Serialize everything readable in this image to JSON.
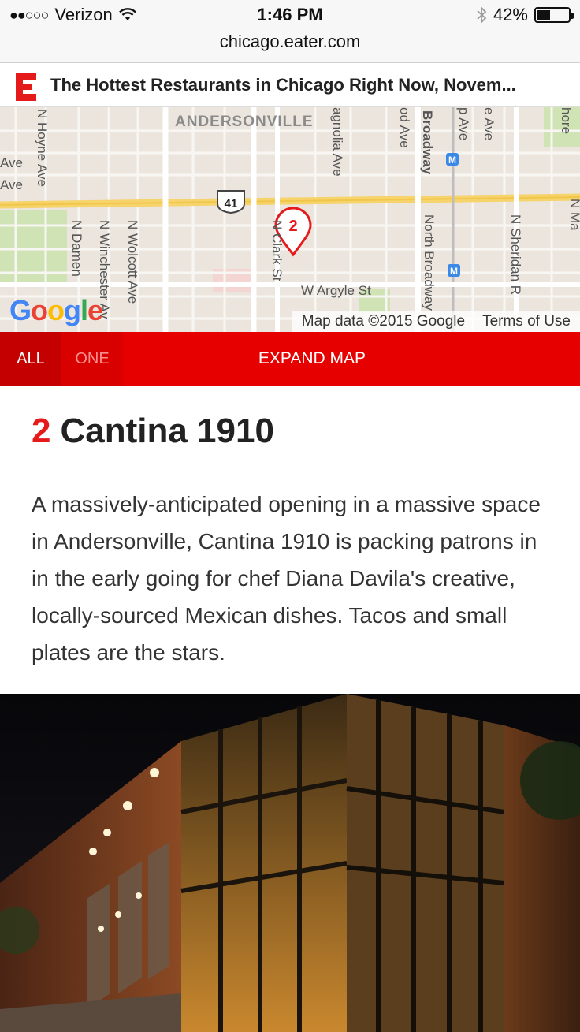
{
  "status": {
    "carrier": "Verizon",
    "time": "1:46 PM",
    "battery": "42%",
    "battery_level": 0.42,
    "url": "chicago.eater.com"
  },
  "header": {
    "logo_letter": "E",
    "title": "The Hottest Restaurants in Chicago Right Now, Novem..."
  },
  "map": {
    "neighborhood": "ANDERSONVILLE",
    "streets": [
      "N Hoyne Ave",
      "N Damen",
      "N Winchester Av",
      "N Wolcott Ave",
      "N Clark St",
      "W Argyle St",
      "Broadway",
      "North Broadway",
      "N Sheridan R",
      "agnolia Ave",
      "od Ave",
      "p Ave",
      "e Ave",
      "Ave",
      "Ave",
      "N Ma",
      "hore"
    ],
    "highway_shield": "41",
    "marker_number": "2",
    "attribution": "Map data ©2015 Google",
    "terms": "Terms of Use",
    "google_logo": "Google"
  },
  "tabs": {
    "all": "ALL",
    "one": "ONE",
    "expand": "EXPAND MAP"
  },
  "entry": {
    "number": "2",
    "name": "Cantina 1910",
    "description": "A massively-anticipated opening in a massive space in Andersonville, Cantina 1910 is packing patrons in in the early going for chef Diana Davila's creative, locally-sourced Mexican dishes. Tacos and small plates are the stars."
  },
  "colors": {
    "brand_red": "#e60000",
    "accent_red": "#e51a1a"
  }
}
